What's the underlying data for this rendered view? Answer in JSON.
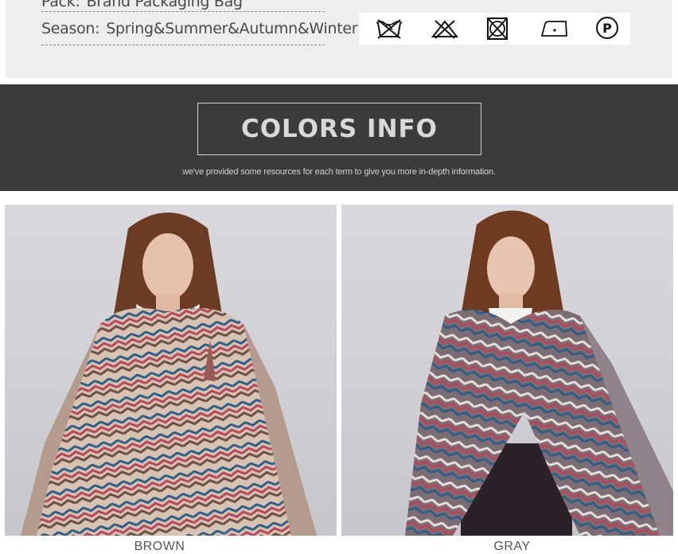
{
  "specs": {
    "pack": {
      "key": "Pack:",
      "value": "Brand Packaging Bag"
    },
    "season": {
      "key": "Season:",
      "value": "Spring&Summer&Autumn&Winter"
    }
  },
  "care_icons": [
    "hand-wash-icon",
    "do-not-bleach-icon",
    "do-not-tumble-dry-icon",
    "low-iron-icon",
    "dry-clean-p-icon"
  ],
  "care_p_letter": "P",
  "banner": {
    "title": "COLORS INFO",
    "subtitle": "we've provided some resources for each term to give you more in-depth information."
  },
  "products": [
    {
      "color_name": "BROWN"
    },
    {
      "color_name": "GRAY"
    }
  ],
  "colors": {
    "banner_bg": "#3b3b3b",
    "panel_bg": "#eeeeee",
    "scarf_brown": "#b59a8e",
    "scarf_gray": "#7c6d74",
    "accent_red": "#b4485a",
    "accent_blue": "#2f5d86"
  }
}
